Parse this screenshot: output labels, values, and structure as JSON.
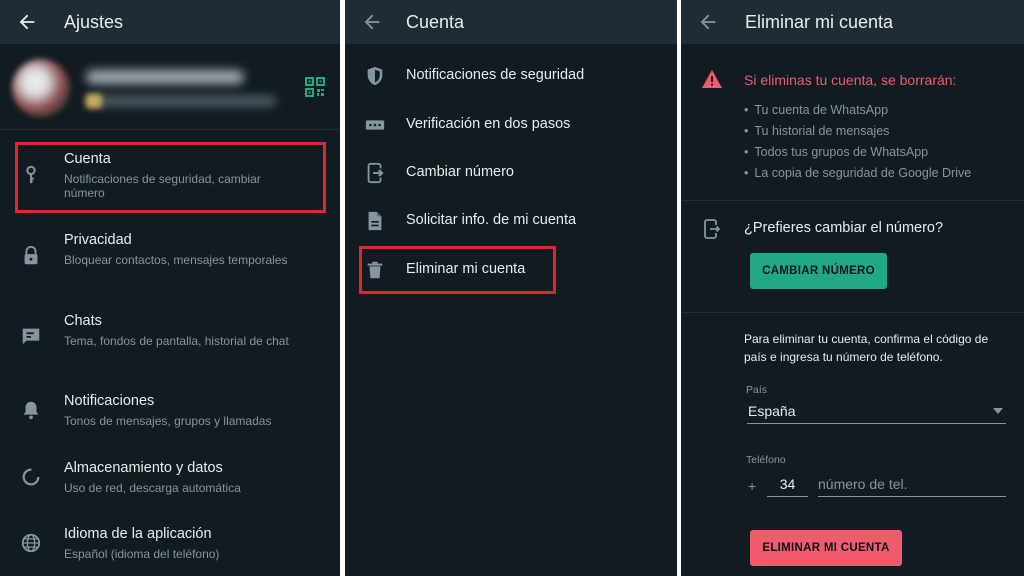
{
  "panel1": {
    "title": "Ajustes",
    "items": [
      {
        "title": "Cuenta",
        "subtitle": "Notificaciones de seguridad, cambiar número",
        "icon": "key-icon"
      },
      {
        "title": "Privacidad",
        "subtitle": "Bloquear contactos, mensajes temporales",
        "icon": "lock-icon"
      },
      {
        "title": "Chats",
        "subtitle": "Tema, fondos de pantalla, historial de chat",
        "icon": "chat-icon"
      },
      {
        "title": "Notificaciones",
        "subtitle": "Tonos de mensajes, grupos y llamadas",
        "icon": "bell-icon"
      },
      {
        "title": "Almacenamiento y datos",
        "subtitle": "Uso de red, descarga automática",
        "icon": "storage-icon"
      },
      {
        "title": "Idioma de la aplicación",
        "subtitle": "Español (idioma del teléfono)",
        "icon": "globe-icon"
      }
    ]
  },
  "panel2": {
    "title": "Cuenta",
    "items": [
      {
        "label": "Notificaciones de seguridad",
        "icon": "shield-icon"
      },
      {
        "label": "Verificación en dos pasos",
        "icon": "dots-icon"
      },
      {
        "label": "Cambiar número",
        "icon": "phone-change-icon"
      },
      {
        "label": "Solicitar info. de mi cuenta",
        "icon": "document-icon"
      },
      {
        "label": "Eliminar mi cuenta",
        "icon": "trash-icon"
      }
    ]
  },
  "panel3": {
    "title": "Eliminar mi cuenta",
    "warning_title": "Si eliminas tu cuenta, se borrarán:",
    "bullets": [
      "Tu cuenta de WhatsApp",
      "Tu historial de mensajes",
      "Todos tus grupos de WhatsApp",
      "La copia de seguridad de Google Drive"
    ],
    "prefer_text": "¿Prefieres cambiar el número?",
    "change_button": "CAMBIAR NÚMERO",
    "instructions": "Para eliminar tu cuenta, confirma el código de país e ingresa tu número de teléfono.",
    "country_label": "País",
    "country_value": "España",
    "phone_label": "Teléfono",
    "plus": "+",
    "country_code": "34",
    "phone_placeholder": "número de tel.",
    "delete_button": "ELIMINAR MI CUENTA"
  },
  "colors": {
    "background": "#111b21",
    "appbar": "#1f2c34",
    "accent_green": "#21a884",
    "danger_red": "#f15c6d",
    "highlight_box": "#e0262c",
    "secondary_text": "#8696a0"
  }
}
